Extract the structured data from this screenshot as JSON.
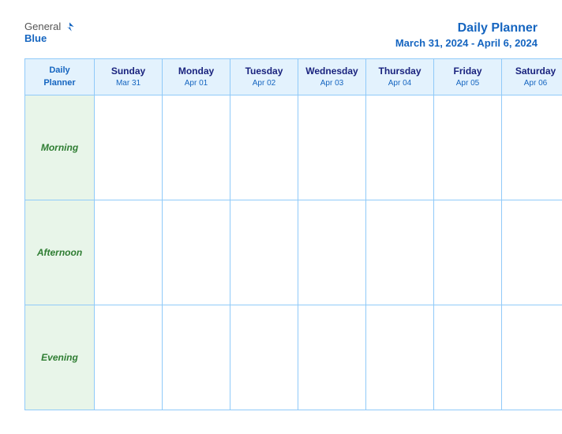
{
  "header": {
    "logo_general": "General",
    "logo_blue": "Blue",
    "title": "Daily Planner",
    "date_range": "March 31, 2024 - April 6, 2024"
  },
  "calendar": {
    "header_label": "Daily\nPlanner",
    "days": [
      {
        "name": "Sunday",
        "date": "Mar 31"
      },
      {
        "name": "Monday",
        "date": "Apr 01"
      },
      {
        "name": "Tuesday",
        "date": "Apr 02"
      },
      {
        "name": "Wednesday",
        "date": "Apr 03"
      },
      {
        "name": "Thursday",
        "date": "Apr 04"
      },
      {
        "name": "Friday",
        "date": "Apr 05"
      },
      {
        "name": "Saturday",
        "date": "Apr 06"
      }
    ],
    "rows": [
      {
        "label": "Morning"
      },
      {
        "label": "Afternoon"
      },
      {
        "label": "Evening"
      }
    ]
  }
}
